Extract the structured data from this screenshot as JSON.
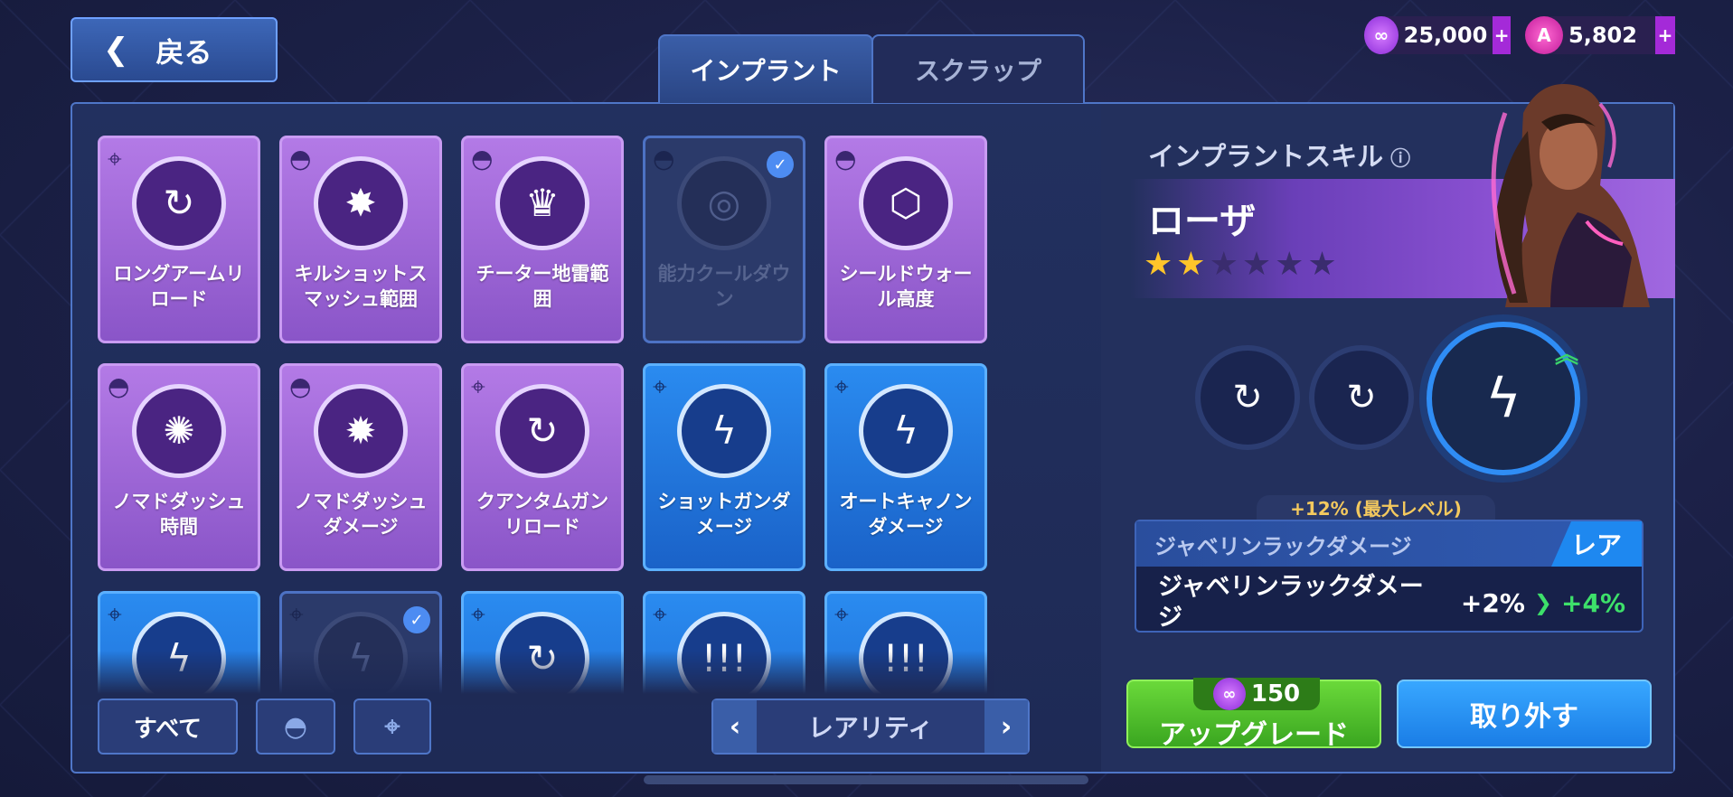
{
  "header": {
    "back_label": "戻る",
    "currency": [
      {
        "icon": "energy-gem-icon",
        "amount": "25,000",
        "plus": "+"
      },
      {
        "icon": "a-token-icon",
        "amount": "5,802",
        "plus": "+"
      }
    ]
  },
  "tabs": [
    {
      "label": "インプラント",
      "active": true
    },
    {
      "label": "スクラップ",
      "active": false
    }
  ],
  "implants": [
    {
      "label": "ロングアームリロード",
      "rarity": "epic",
      "type": "crosshair-icon",
      "icon": "↻"
    },
    {
      "label": "キルショットスマッシュ範囲",
      "rarity": "epic",
      "type": "mask-icon",
      "icon": "✸"
    },
    {
      "label": "チーター地雷範囲",
      "rarity": "epic",
      "type": "mask-icon",
      "icon": "♛"
    },
    {
      "label": "能力クールダウン",
      "rarity": "equipped",
      "type": "mask-icon",
      "icon": "◎",
      "equipped": true
    },
    {
      "label": "シールドウォール高度",
      "rarity": "epic",
      "type": "mask-icon",
      "icon": "⬡"
    },
    {
      "label": "ノマドダッシュ時間",
      "rarity": "epic",
      "type": "mask-icon",
      "icon": "✺"
    },
    {
      "label": "ノマドダッシュダメージ",
      "rarity": "epic",
      "type": "mask-icon",
      "icon": "✹"
    },
    {
      "label": "クアンタムガンリロード",
      "rarity": "epic",
      "type": "crosshair-icon",
      "icon": "↻"
    },
    {
      "label": "ショットガンダメージ",
      "rarity": "rare",
      "type": "crosshair-icon",
      "icon": "ϟ"
    },
    {
      "label": "オートキャノンダメージ",
      "rarity": "rare",
      "type": "crosshair-icon",
      "icon": "ϟ"
    },
    {
      "label": "",
      "rarity": "rare",
      "type": "crosshair-icon",
      "icon": "ϟ"
    },
    {
      "label": "",
      "rarity": "equipped",
      "type": "crosshair-icon",
      "icon": "ϟ",
      "equipped": true
    },
    {
      "label": "",
      "rarity": "rare",
      "type": "crosshair-icon",
      "icon": "↻"
    },
    {
      "label": "",
      "rarity": "rare",
      "type": "crosshair-icon",
      "icon": "!!!"
    },
    {
      "label": "",
      "rarity": "rare",
      "type": "crosshair-icon",
      "icon": "!!!"
    }
  ],
  "filters": {
    "all_label": "すべて",
    "mask_icon": "mask-icon",
    "crosshair_icon": "crosshair-icon",
    "sort_label": "レアリティ",
    "prev": "‹",
    "next": "›"
  },
  "skill_panel": {
    "title": "インプラントスキル",
    "info_icon": "ⓘ",
    "character_name": "ローザ",
    "stars_filled": 2,
    "stars_total": 6,
    "slots": [
      {
        "icon": "↻",
        "progress": 0.35,
        "color": "#2f8df5"
      },
      {
        "icon": "↻",
        "progress": 0.3,
        "color": "#a37be0"
      },
      {
        "icon": "ϟ",
        "progress": 0.25,
        "color": "#2f8df5",
        "selected": true
      }
    ],
    "bonus_label": "+12%  (最大レベル)",
    "stat_header": "ジャベリンラックダメージ",
    "rarity": "レア",
    "stat_name": "ジャベリンラックダメージ",
    "stat_current": "+2%",
    "stat_next": "+4%",
    "upgrade_cost": "150",
    "upgrade_label": "アップグレード",
    "remove_label": "取り外す"
  }
}
